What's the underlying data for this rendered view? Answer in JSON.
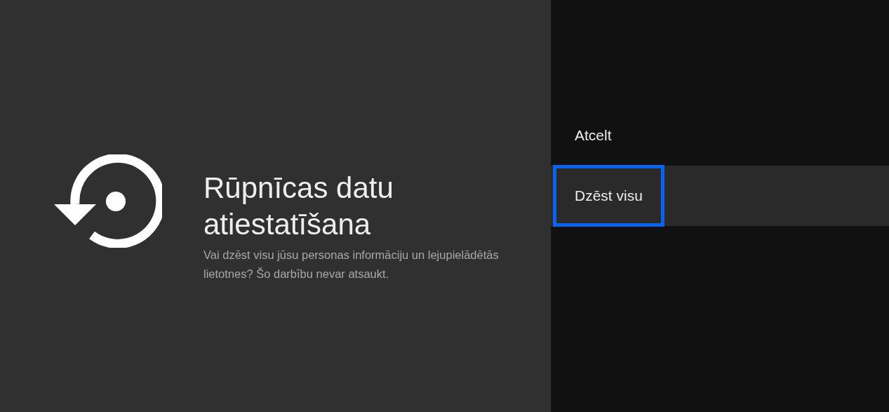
{
  "dialog": {
    "title_lines": [
      "Rūpnīcas datu",
      "atiestatīšana"
    ],
    "description": "Vai dzēst visu jūsu personas informāciju un lejupielādētās lietotnes? Šo darbību nevar atsaukt."
  },
  "actions": [
    {
      "label": "Atcelt",
      "selected": false
    },
    {
      "label": "Dzēst visu",
      "selected": true
    }
  ]
}
